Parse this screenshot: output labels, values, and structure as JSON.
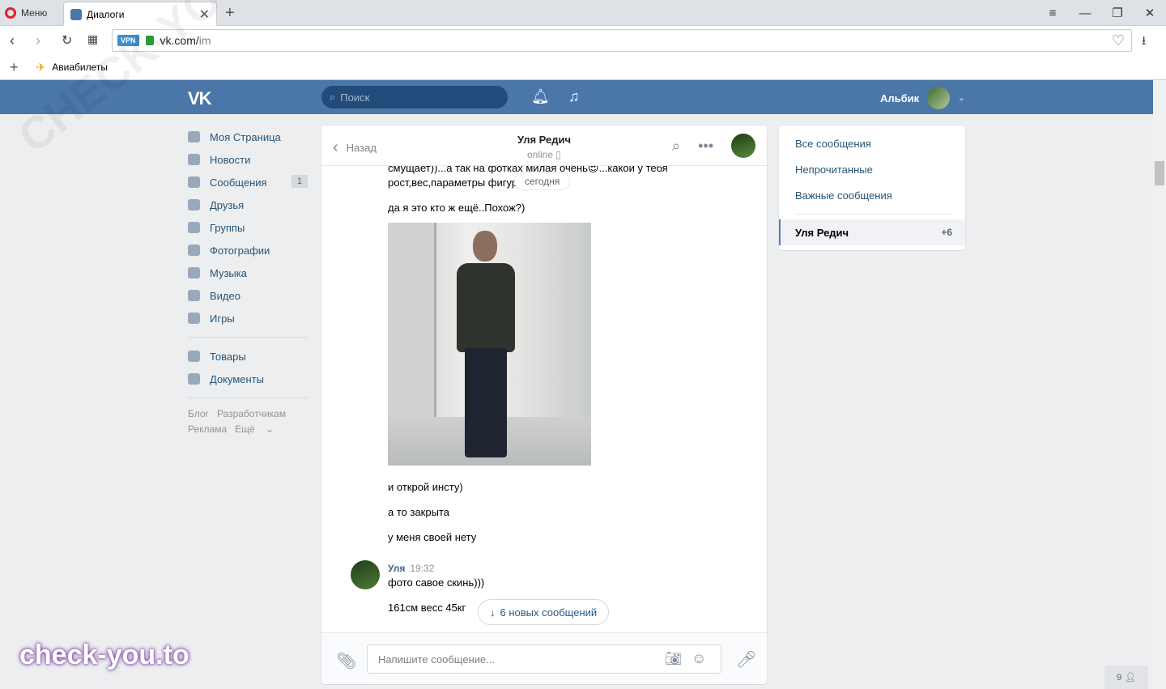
{
  "browser": {
    "menu_label": "Меню",
    "tab_title": "Диалоги",
    "url_main": "vk.com/",
    "url_path": "im",
    "vpn_label": "VPN",
    "bookmark_label": "Авиабилеты"
  },
  "header": {
    "logo": "VK",
    "search_placeholder": "Поиск",
    "user_name": "Альбик"
  },
  "nav": {
    "items": [
      {
        "label": "Моя Страница",
        "icon": "home-icon"
      },
      {
        "label": "Новости",
        "icon": "news-icon"
      },
      {
        "label": "Сообщения",
        "icon": "messages-icon",
        "badge": "1"
      },
      {
        "label": "Друзья",
        "icon": "friends-icon"
      },
      {
        "label": "Группы",
        "icon": "groups-icon"
      },
      {
        "label": "Фотографии",
        "icon": "photos-icon"
      },
      {
        "label": "Музыка",
        "icon": "music-icon"
      },
      {
        "label": "Видео",
        "icon": "video-icon"
      },
      {
        "label": "Игры",
        "icon": "games-icon"
      }
    ],
    "items2": [
      {
        "label": "Товары",
        "icon": "goods-icon"
      },
      {
        "label": "Документы",
        "icon": "documents-icon"
      }
    ],
    "footer": {
      "blog": "Блог",
      "dev": "Разработчикам",
      "ads": "Реклама",
      "more": "Ещё"
    }
  },
  "chat": {
    "back_label": "Назад",
    "title": "Уля Редич",
    "status": "online",
    "date_label": "сегодня",
    "messages": [
      "смущает))...а так на фотках милая очень😍...какой у тебя",
      "рост,вес,параметры фигуры (груди?)",
      "да я это кто ж ещё..Похож?)",
      "и открой инсту)",
      "а то закрыта",
      "у меня своей нету"
    ],
    "peer_author": "Уля",
    "peer_time": "19:32",
    "peer_messages": [
      "фото савое скинь)))",
      "161см весс 45кг"
    ],
    "new_messages_label": "6 новых сообщений",
    "input_placeholder": "Напишите сообщение..."
  },
  "right_panel": {
    "all": "Все сообщения",
    "unread": "Непрочитанные",
    "important": "Важные сообщения",
    "active_dialog": "Уля Редич",
    "active_count": "+6"
  },
  "misc": {
    "online_count": "9",
    "watermark": "CHECK-YOU.ME",
    "watermark_bottom": "check-you.to"
  },
  "colors": {
    "vk_blue": "#4a76a8",
    "link_blue": "#285473",
    "bg": "#edeef0"
  }
}
